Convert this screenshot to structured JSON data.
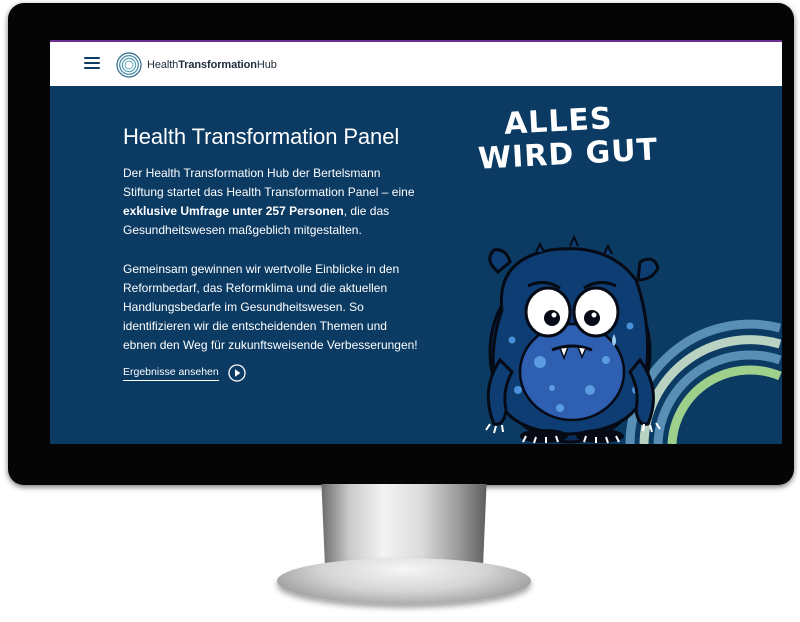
{
  "header": {
    "menu_icon": "hamburger-menu-icon",
    "logo_part1": "Health",
    "logo_part2": "Transformation",
    "logo_part3": "Hub",
    "accent_color": "#6b2d8f"
  },
  "hero": {
    "title": "Health Transformation Panel",
    "p1_a": "Der Health Transformation Hub der Bertelsmann Stiftung startet das Health Transformation Panel – eine ",
    "p1_bold": "exklusive Umfrage unter 257 Personen",
    "p1_b": ", die das Gesundheitswesen maßgeblich mitgestalten.",
    "p2": "Gemeinsam gewinnen wir wertvolle Einblicke in den Reformbedarf, das Reformklima und die aktuellen Handlungsbedarfe im Gesundheitswesen. So identifizieren wir die entscheidenden Themen und ebnen den Weg für zukunftsweisende Verbesserungen!",
    "cta_label": "Ergebnisse ansehen",
    "cta_icon": "play-circle-icon",
    "background_color": "#0b3a63"
  },
  "illustration": {
    "slogan_line1": "ALLES",
    "slogan_line2": "WIRD GUT",
    "monster_color": "#0e3d73",
    "belly_color": "#2e5fb0",
    "arc_colors": [
      "#5a8fb5",
      "#b9d2c2",
      "#5a8fb5",
      "#9fd08b"
    ]
  }
}
